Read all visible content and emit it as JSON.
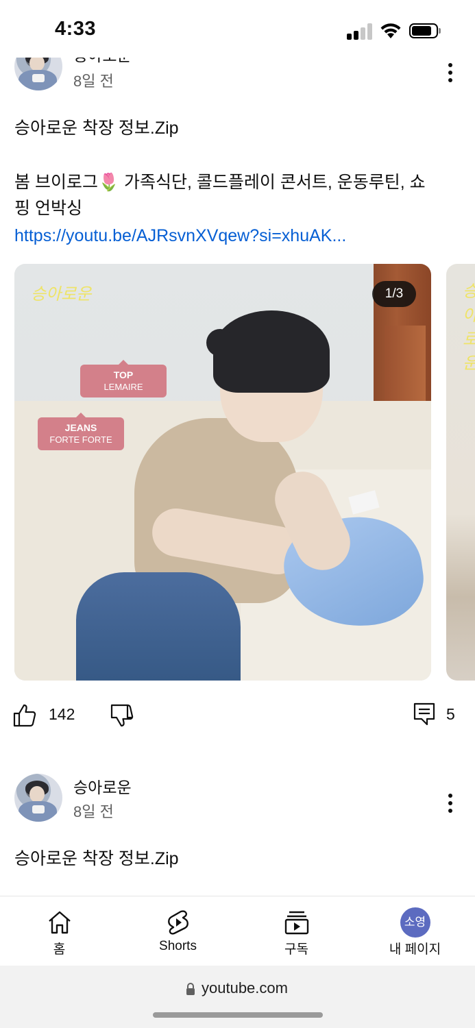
{
  "status_bar": {
    "time": "4:33"
  },
  "posts": [
    {
      "channel_name": "승아로운",
      "time_ago": "8일 전",
      "text_line1": "승아로운 착장 정보.Zip",
      "text_line2": "봄 브이로그🌷 가족식단, 콜드플레이 콘서트, 운동루틴, 쇼",
      "text_line3": "핑 언박싱",
      "link": "https://youtu.be/AJRsvnXVqew?si=xhuAK...",
      "image": {
        "watermark": "승아로운",
        "counter": "1/3",
        "tag1_title": "TOP",
        "tag1_brand": "LEMAIRE",
        "tag2_title": "JEANS",
        "tag2_brand": "FORTE FORTE"
      },
      "likes": "142",
      "comments": "5"
    },
    {
      "channel_name": "승아로운",
      "time_ago": "8일 전",
      "text_line1": "승아로운 착장 정보.Zip"
    }
  ],
  "bottom_nav": {
    "home": "홈",
    "shorts": "Shorts",
    "subscriptions": "구독",
    "you": "내 페이지",
    "avatar_text": "소영"
  },
  "browser": {
    "url": "youtube.com"
  },
  "icons": [
    "signal-icon",
    "wifi-icon",
    "battery-icon",
    "more-vert-icon",
    "like-icon",
    "dislike-icon",
    "comment-icon",
    "home-icon",
    "shorts-icon",
    "subscriptions-icon",
    "lock-icon"
  ]
}
